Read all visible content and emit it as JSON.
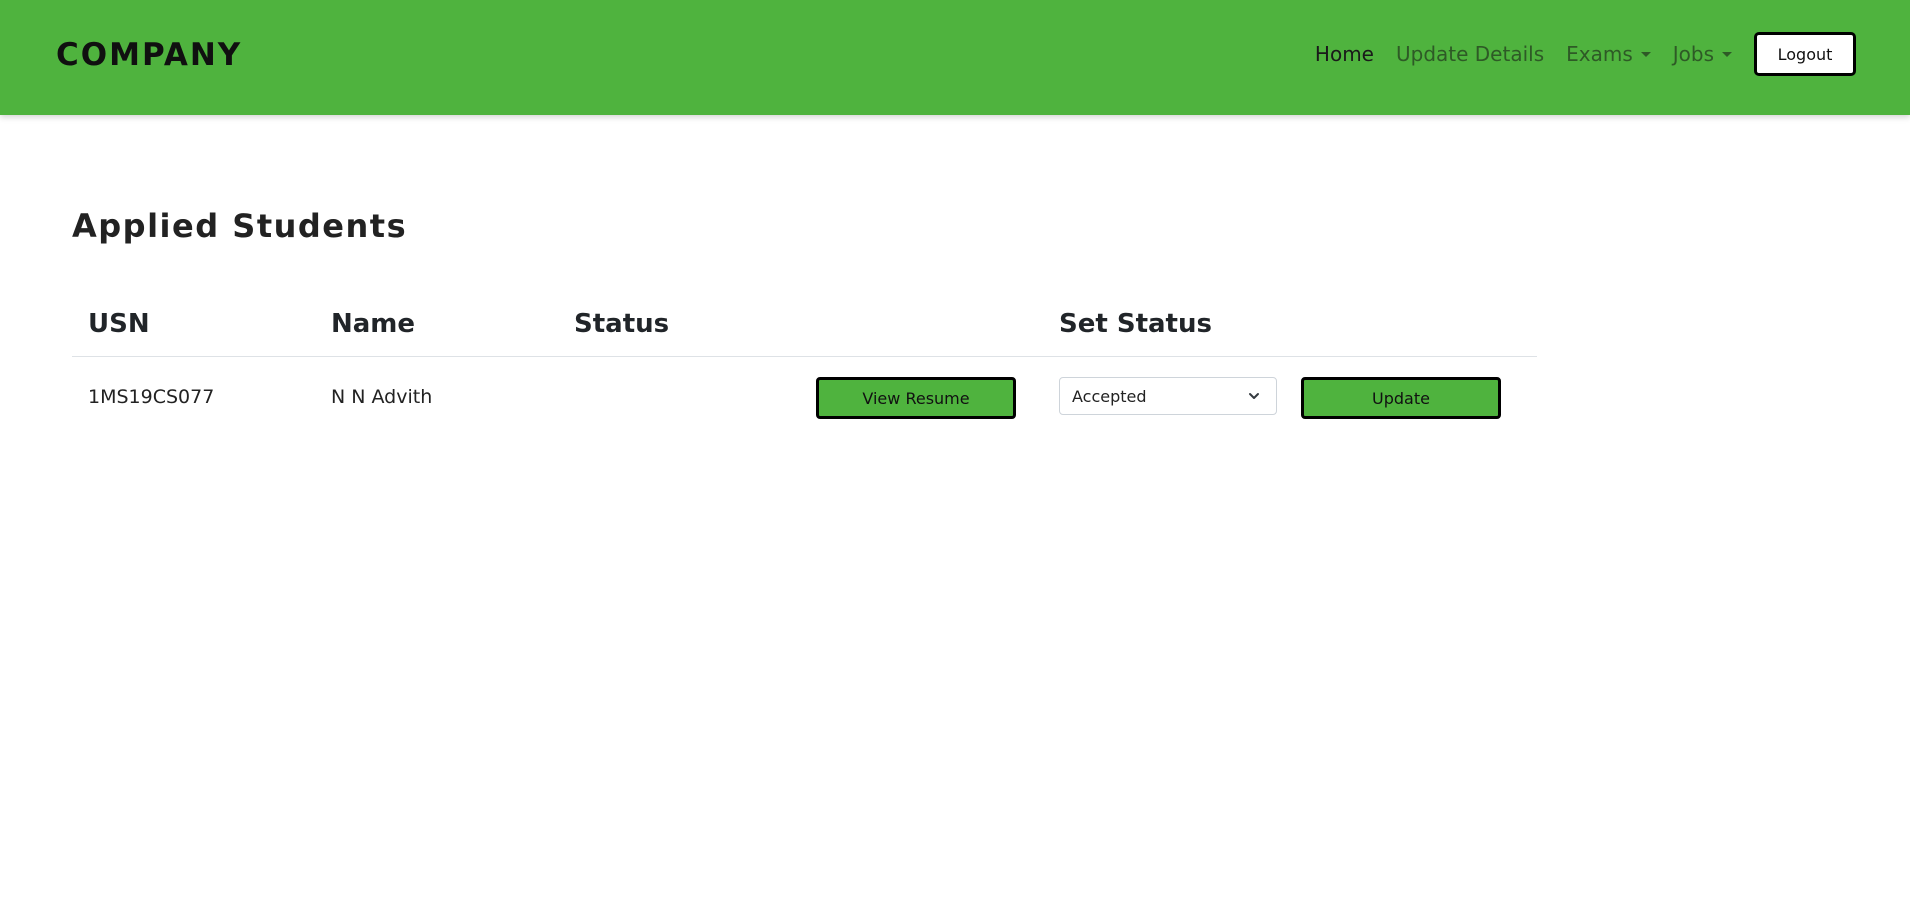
{
  "navbar": {
    "brand": "COMPANY",
    "links": [
      {
        "label": "Home",
        "active": true,
        "dropdown": false
      },
      {
        "label": "Update Details",
        "active": false,
        "dropdown": false
      },
      {
        "label": "Exams",
        "active": false,
        "dropdown": true
      },
      {
        "label": "Jobs",
        "active": false,
        "dropdown": true
      }
    ],
    "logout_label": "Logout"
  },
  "page": {
    "title": "Applied Students"
  },
  "table": {
    "headers": [
      "USN",
      "Name",
      "Status",
      "",
      "Set Status",
      ""
    ],
    "rows": [
      {
        "usn": "1MS19CS077",
        "name": "N N Advith",
        "status": "",
        "view_resume_label": "View Resume",
        "set_status_value": "Accepted",
        "update_label": "Update"
      }
    ]
  },
  "colors": {
    "navbar": "#4fb33e",
    "button": "#4fb33e",
    "button_border": "#000000"
  },
  "icons": {
    "select_arrow": "chevron-down-icon",
    "dropdown_caret": "caret-down-icon"
  }
}
